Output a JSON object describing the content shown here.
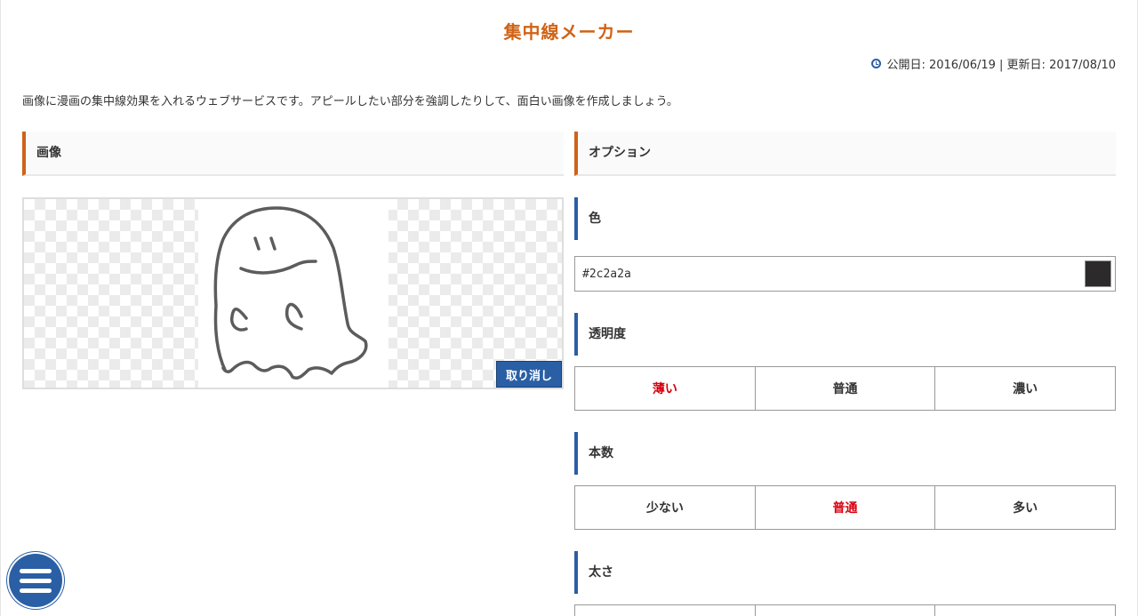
{
  "page": {
    "title": "集中線メーカー",
    "published": "公開日: 2016/06/19 | 更新日: 2017/08/10",
    "description": "画像に漫画の集中線効果を入れるウェブサービスです。アピールしたい部分を強調したりして、面白い画像を作成しましょう。"
  },
  "image_section": {
    "heading": "画像",
    "undo_label": "取り消し"
  },
  "options": {
    "heading": "オプション",
    "color": {
      "label": "色",
      "value": "#2c2a2a"
    },
    "opacity": {
      "label": "透明度",
      "choices": [
        "薄い",
        "普通",
        "濃い"
      ],
      "selected": 0
    },
    "count": {
      "label": "本数",
      "choices": [
        "少ない",
        "普通",
        "多い"
      ],
      "selected": 1
    },
    "thickness": {
      "label": "太さ"
    }
  },
  "icons": {
    "clock": "clock-icon",
    "menu": "hamburger-menu-icon",
    "ghost": "ghost-drawing"
  },
  "colors": {
    "accent_orange": "#cf6317",
    "accent_blue": "#2a5fa5",
    "active_red": "#d8000f",
    "swatch": "#2c2a2a"
  }
}
